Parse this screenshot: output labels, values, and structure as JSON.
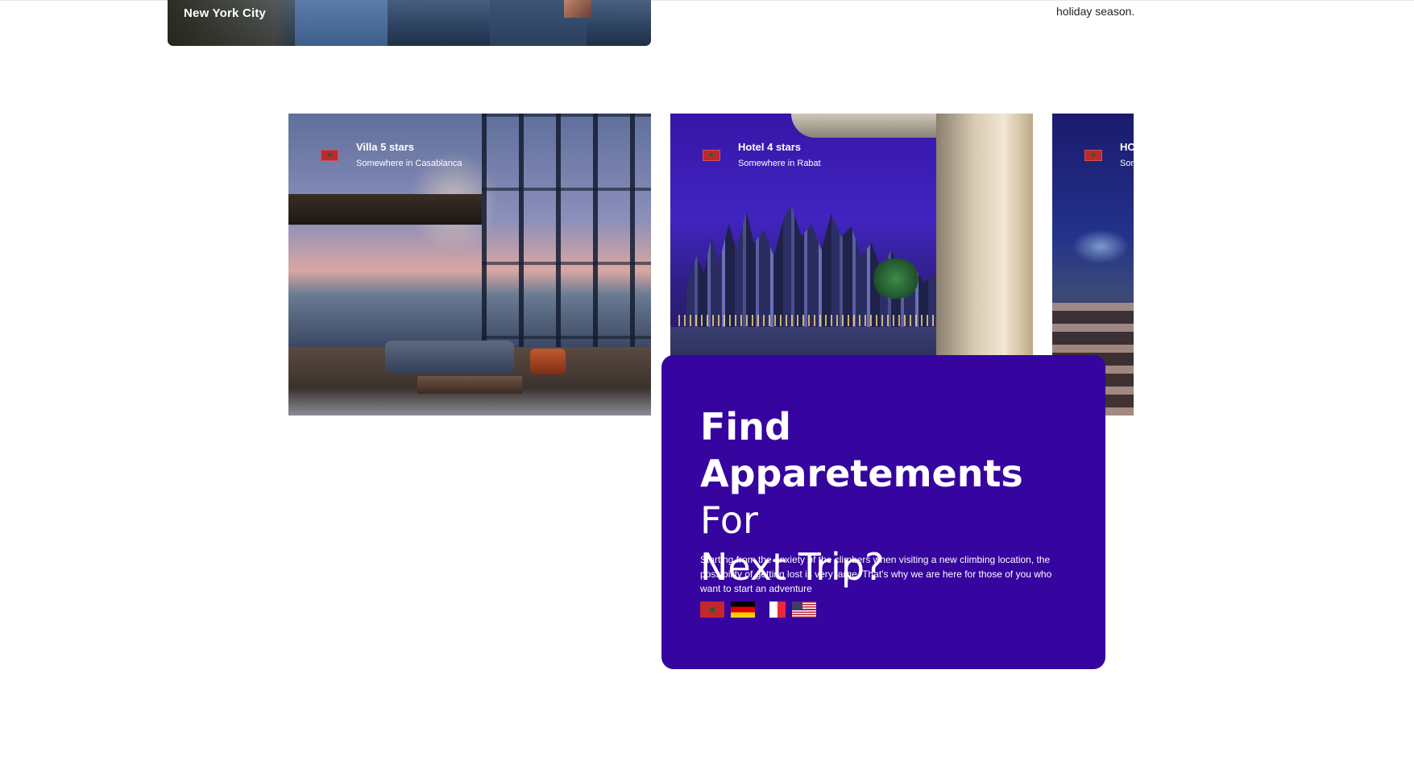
{
  "top": {
    "nyc_caption": "New York City",
    "holiday_text": "holiday season."
  },
  "hotels": [
    {
      "title": "Villa 5 stars",
      "location": "Somewhere in Casablanca",
      "flag_icon": "morocco-flag-icon"
    },
    {
      "title": "Hotel 4 stars",
      "location": "Somewhere in Rabat",
      "flag_icon": "morocco-flag-icon"
    },
    {
      "title": "HO",
      "location": "Son",
      "flag_icon": "morocco-flag-icon"
    }
  ],
  "promo": {
    "title_bold": "Find Appareteements",
    "title_light": "For Next Trip?",
    "description": "Starting from the anxiety of the climbers when visiting a new climbing location, the possibility of getting lost is very large. That's why we are here for those of you who want to start an adventure",
    "languages": [
      "morocco-flag-icon",
      "germany-flag-icon",
      "france-flag-icon",
      "usa-flag-icon"
    ],
    "background_color": "#36049f"
  },
  "flag_star": "★"
}
